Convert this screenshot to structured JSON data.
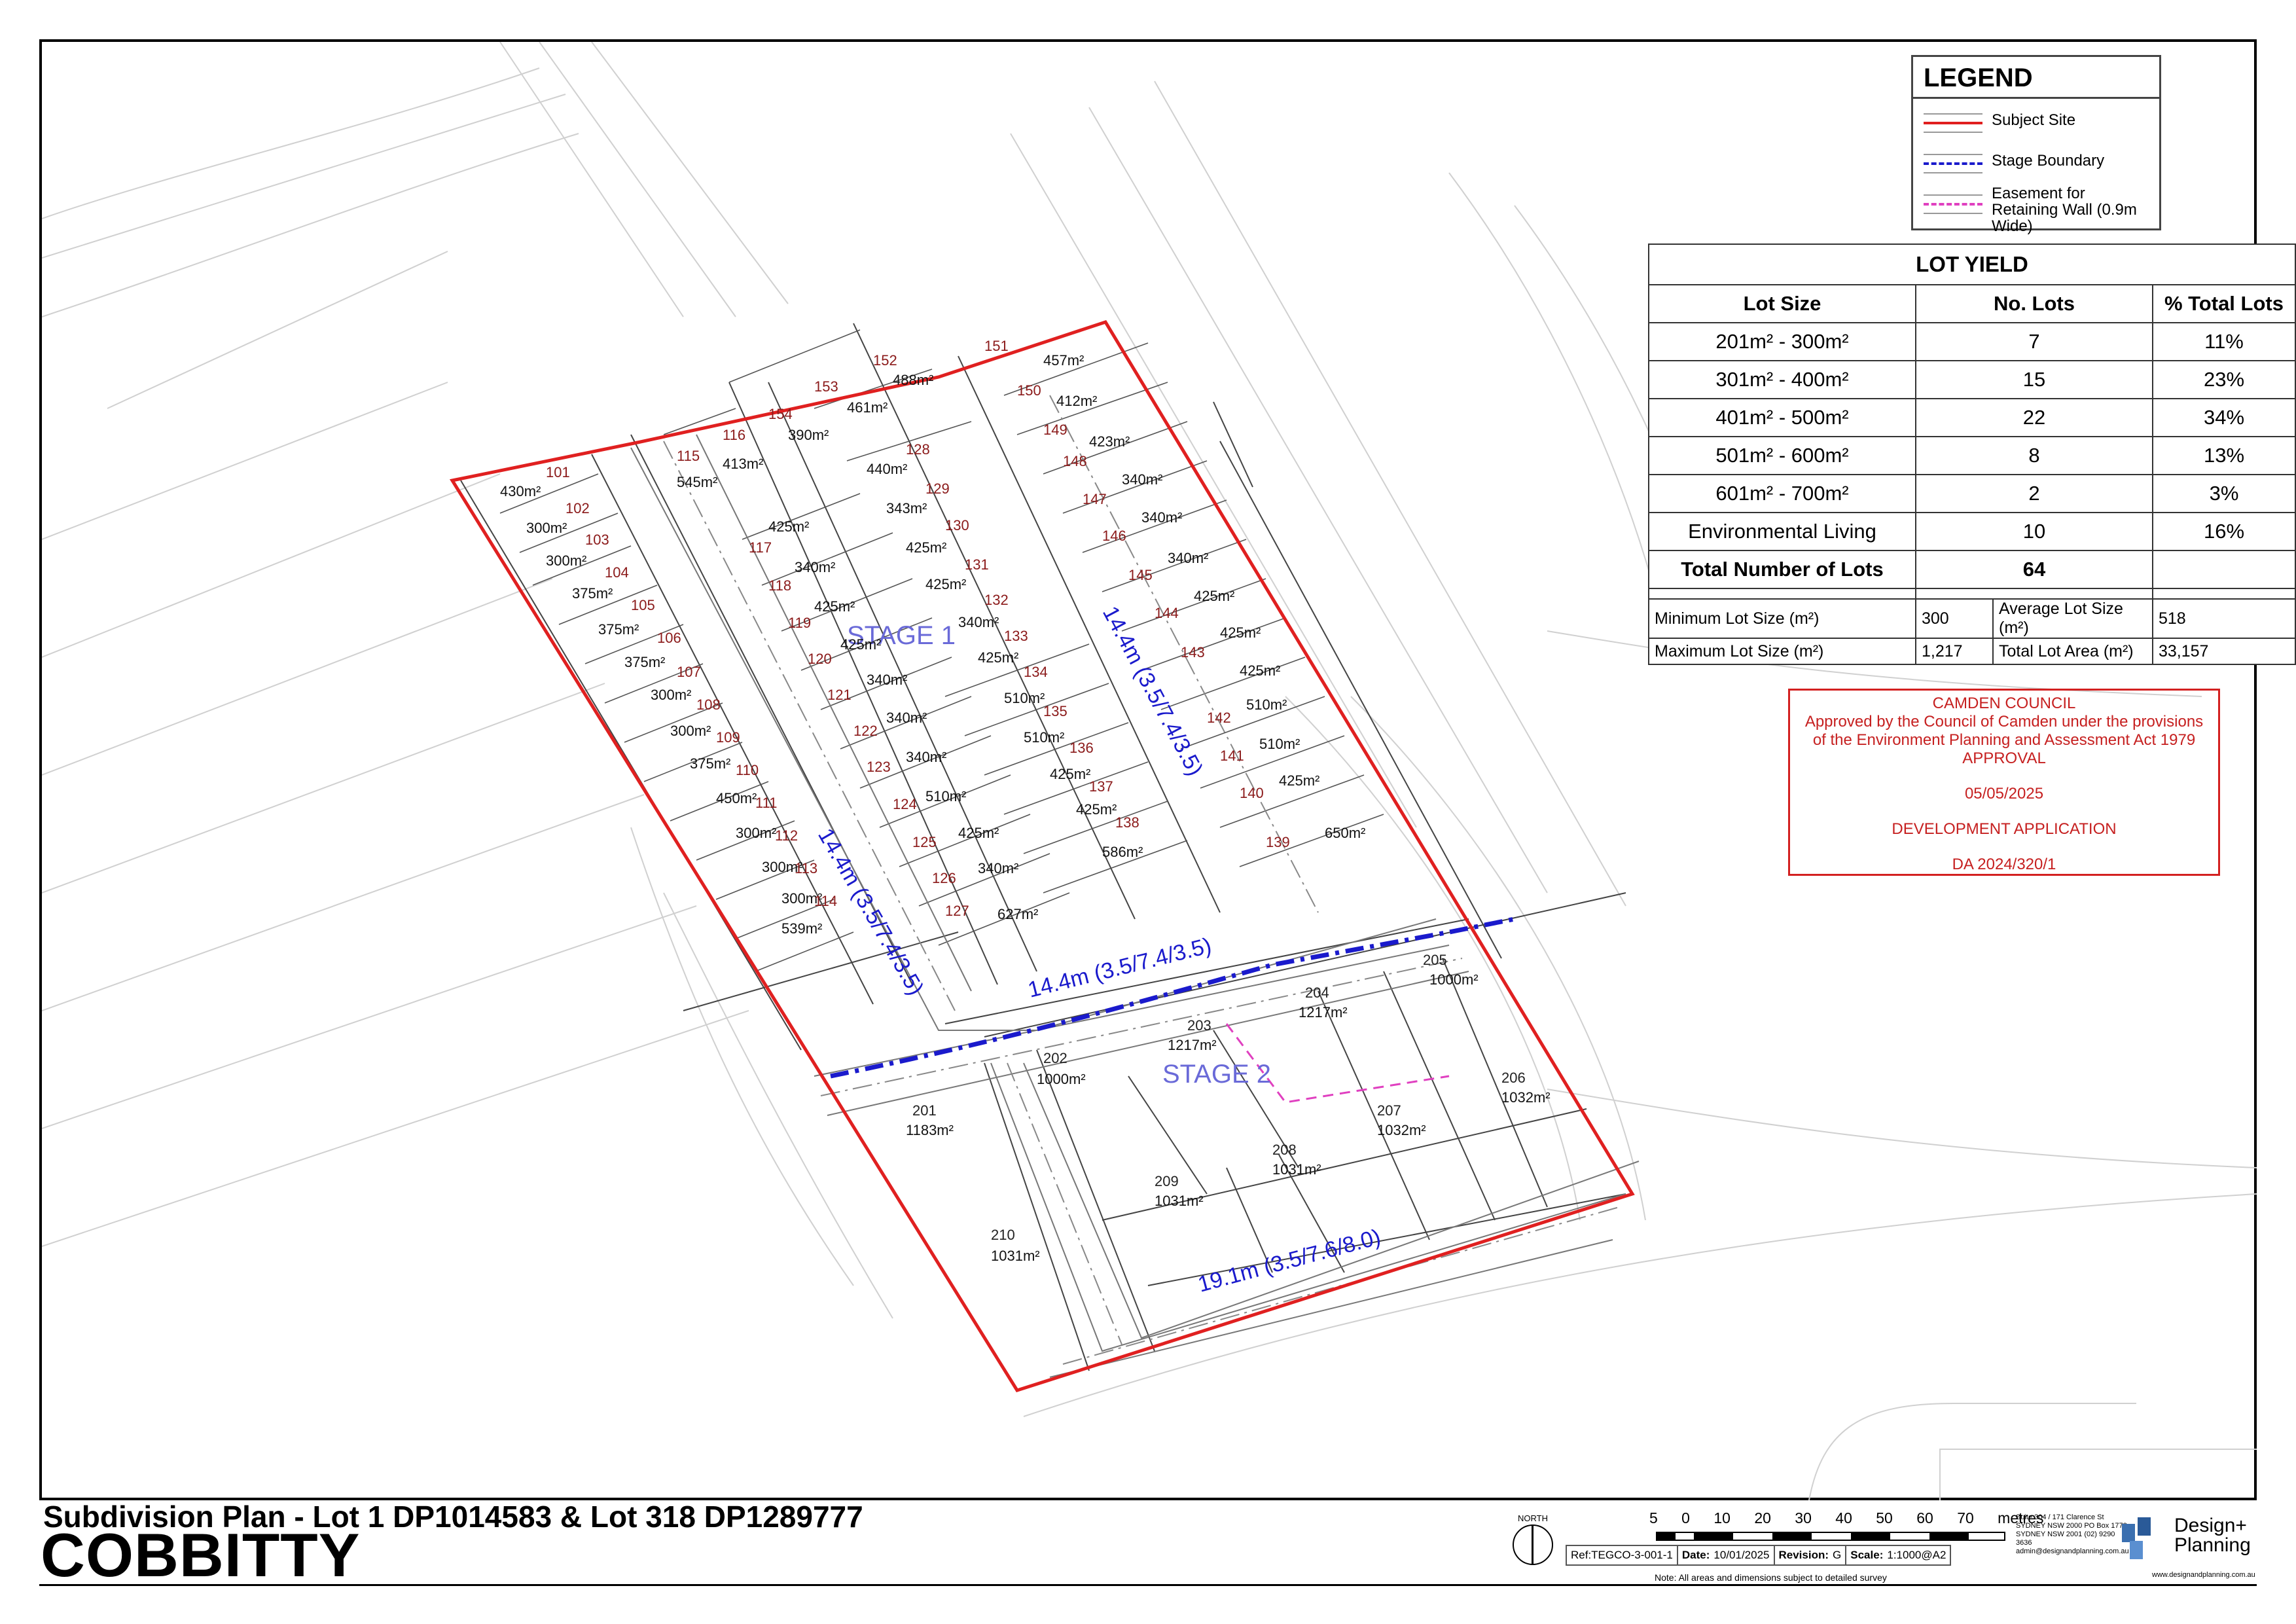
{
  "legend": {
    "title": "LEGEND",
    "items": [
      {
        "label": "Subject Site",
        "color": "#e02020",
        "style": "solid"
      },
      {
        "label": "Stage Boundary",
        "color": "#1a1acc",
        "style": "dash-dot"
      },
      {
        "label": "Easement for Retaining Wall (0.9m Wide)",
        "color": "#e040c0",
        "style": "dashed"
      }
    ]
  },
  "lot_yield": {
    "title": "LOT YIELD",
    "headers": [
      "Lot Size",
      "No. Lots",
      "% Total Lots"
    ],
    "rows": [
      [
        "201m² - 300m²",
        "7",
        "11%"
      ],
      [
        "301m² - 400m²",
        "15",
        "23%"
      ],
      [
        "401m² - 500m²",
        "22",
        "34%"
      ],
      [
        "501m² - 600m²",
        "8",
        "13%"
      ],
      [
        "601m² - 700m²",
        "2",
        "3%"
      ],
      [
        "Environmental Living",
        "10",
        "16%"
      ]
    ],
    "total_label": "Total Number of Lots",
    "total_value": "64",
    "min_label": "Minimum Lot Size (m²)",
    "min_value": "300",
    "avg_label": "Average Lot Size (m²)",
    "avg_value": "518",
    "max_label": "Maximum Lot Size (m²)",
    "max_value": "1,217",
    "area_label": "Total Lot Area (m²)",
    "area_value": "33,157"
  },
  "approval": {
    "line1": "CAMDEN COUNCIL",
    "line2": "Approved by the Council of Camden under the provisions",
    "line3": "of the Environment Planning and Assessment Act 1979",
    "line4": "APPROVAL",
    "date": "05/05/2025",
    "type": "DEVELOPMENT APPLICATION",
    "da": "DA 2024/320/1"
  },
  "plan": {
    "stage1_label": "STAGE 1",
    "stage2_label": "STAGE 2",
    "road_labels": [
      "14.4m (3.5/7.4/3.5)",
      "14.4m (3.5/7.4/3.5)",
      "14.4m (3.5/7.4/3.5)",
      "19.1m (3.5/7.6/8.0)"
    ],
    "lots": [
      {
        "n": "101",
        "a": "430m²"
      },
      {
        "n": "102",
        "a": "300m²"
      },
      {
        "n": "103",
        "a": "300m²"
      },
      {
        "n": "104",
        "a": "375m²"
      },
      {
        "n": "105",
        "a": "375m²"
      },
      {
        "n": "106",
        "a": "375m²"
      },
      {
        "n": "107",
        "a": "300m²"
      },
      {
        "n": "108",
        "a": "300m²"
      },
      {
        "n": "109",
        "a": "375m²"
      },
      {
        "n": "110",
        "a": "450m²"
      },
      {
        "n": "111",
        "a": "300m²"
      },
      {
        "n": "112",
        "a": "300m²"
      },
      {
        "n": "113",
        "a": "300m²"
      },
      {
        "n": "114",
        "a": "539m²"
      },
      {
        "n": "115",
        "a": "545m²"
      },
      {
        "n": "116",
        "a": "413m²"
      },
      {
        "n": "117",
        "a": "425m²"
      },
      {
        "n": "118",
        "a": "340m²"
      },
      {
        "n": "119",
        "a": "425m²"
      },
      {
        "n": "120",
        "a": "425m²"
      },
      {
        "n": "121",
        "a": "340m²"
      },
      {
        "n": "122",
        "a": "340m²"
      },
      {
        "n": "123",
        "a": "340m²"
      },
      {
        "n": "124",
        "a": "510m²"
      },
      {
        "n": "125",
        "a": "425m²"
      },
      {
        "n": "126",
        "a": "340m²"
      },
      {
        "n": "127",
        "a": "627m²"
      },
      {
        "n": "128",
        "a": "440m²"
      },
      {
        "n": "129",
        "a": "343m²"
      },
      {
        "n": "130",
        "a": "425m²"
      },
      {
        "n": "131",
        "a": "425m²"
      },
      {
        "n": "132",
        "a": "340m²"
      },
      {
        "n": "133",
        "a": "425m²"
      },
      {
        "n": "134",
        "a": "510m²"
      },
      {
        "n": "135",
        "a": "510m²"
      },
      {
        "n": "136",
        "a": "425m²"
      },
      {
        "n": "137",
        "a": "425m²"
      },
      {
        "n": "138",
        "a": "586m²"
      },
      {
        "n": "139",
        "a": "650m²"
      },
      {
        "n": "140",
        "a": "425m²"
      },
      {
        "n": "141",
        "a": "510m²"
      },
      {
        "n": "142",
        "a": "510m²"
      },
      {
        "n": "143",
        "a": "425m²"
      },
      {
        "n": "144",
        "a": "425m²"
      },
      {
        "n": "145",
        "a": "425m²"
      },
      {
        "n": "146",
        "a": "340m²"
      },
      {
        "n": "147",
        "a": "340m²"
      },
      {
        "n": "148",
        "a": "340m²"
      },
      {
        "n": "149",
        "a": "423m²"
      },
      {
        "n": "150",
        "a": "412m²"
      },
      {
        "n": "151",
        "a": "457m²"
      },
      {
        "n": "152",
        "a": "488m²"
      },
      {
        "n": "153",
        "a": "461m²"
      },
      {
        "n": "154",
        "a": "390m²"
      },
      {
        "n": "201",
        "a": "1183m²"
      },
      {
        "n": "202",
        "a": "1000m²"
      },
      {
        "n": "203",
        "a": "1217m²"
      },
      {
        "n": "204",
        "a": "1217m²"
      },
      {
        "n": "205",
        "a": "1000m²"
      },
      {
        "n": "206",
        "a": "1032m²"
      },
      {
        "n": "207",
        "a": "1032m²"
      },
      {
        "n": "208",
        "a": "1031m²"
      },
      {
        "n": "209",
        "a": "1031m²"
      },
      {
        "n": "210",
        "a": "1031m²"
      }
    ]
  },
  "title": {
    "subtitle": "Subdivision Plan - Lot 1 DP1014583 & Lot 318 DP1289777",
    "place": "COBBITTY"
  },
  "titleblock": {
    "north": "NORTH",
    "scale_ticks": "5 0 10 20 30 40 50 60 70 metres",
    "ref": "Ref:TEGCO-3-001-1",
    "date_label": "Date:",
    "date": "10/01/2025",
    "revision_label": "Revision:",
    "revision": "G",
    "scale_label": "Scale:",
    "scale": "1:1000@A2",
    "note": "Note: All areas and dimensions subject to detailed survey",
    "address": "Suite 304 / 171 Clarence St SYDNEY NSW 2000 PO Box 1778 SYDNEY NSW 2001 (02) 9290 3636 admin@designandplanning.com.au",
    "company": "Design+ Planning",
    "website": "www.designandplanning.com.au"
  },
  "colors": {
    "site": "#e02020",
    "stage": "#1a1acc",
    "easement": "#e040c0",
    "lot_number": "#8b1a1a",
    "stage_label": "#6a6ad8"
  }
}
